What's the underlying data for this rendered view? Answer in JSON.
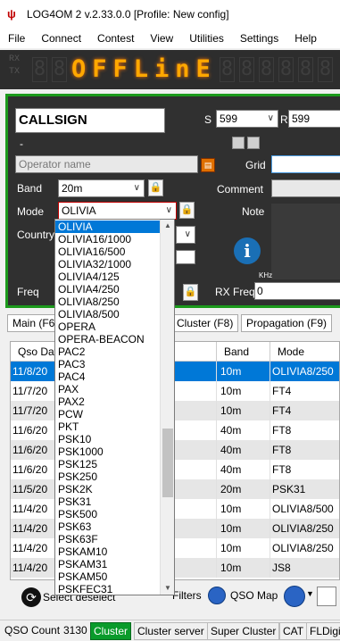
{
  "window": {
    "title": "LOG4OM 2 v.2.33.0.0 [Profile: New config]"
  },
  "menu": [
    "File",
    "Connect",
    "Contest",
    "View",
    "Utilities",
    "Settings",
    "Help"
  ],
  "led": {
    "rx_label": "RX",
    "tx_label": "TX",
    "display_text": "OFFLinE"
  },
  "qso_form": {
    "callsign_placeholder": "CALLSIGN",
    "dash": "-",
    "rst_sent_label": "S",
    "rst_sent_value": "599",
    "rst_rcvd_label": "R",
    "rst_rcvd_value": "599",
    "operator_placeholder": "Operator name",
    "grid_label": "Grid",
    "band_label": "Band",
    "band_value": "20m",
    "comment_label": "Comment",
    "mode_label": "Mode",
    "mode_value": "OLIVIA",
    "note_label": "Note",
    "country_label": "Country",
    "freq_label": "Freq",
    "rx_freq_label": "RX Freq",
    "rx_freq_value": "0",
    "khz_label": "KHz"
  },
  "tabs": [
    "Main (F6",
    "Cluster (F8)",
    "Propagation (F9)"
  ],
  "grid": {
    "columns": [
      "Qso Date",
      "Band",
      "Mode"
    ],
    "rows": [
      {
        "date": "11/8/20",
        "band": "10m",
        "mode": "OLIVIA8/250"
      },
      {
        "date": "11/7/20",
        "band": "10m",
        "mode": "FT4"
      },
      {
        "date": "11/7/20",
        "band": "10m",
        "mode": "FT4"
      },
      {
        "date": "11/6/20",
        "band": "40m",
        "mode": "FT8"
      },
      {
        "date": "11/6/20",
        "band": "40m",
        "mode": "FT8"
      },
      {
        "date": "11/6/20",
        "band": "40m",
        "mode": "FT8"
      },
      {
        "date": "11/5/20",
        "band": "20m",
        "mode": "PSK31"
      },
      {
        "date": "11/4/20",
        "band": "10m",
        "mode": "OLIVIA8/500"
      },
      {
        "date": "11/4/20",
        "band": "10m",
        "mode": "OLIVIA8/250"
      },
      {
        "date": "11/4/20",
        "band": "10m",
        "mode": "OLIVIA8/250"
      },
      {
        "date": "11/4/20",
        "band": "10m",
        "mode": "JS8"
      }
    ]
  },
  "bottom_toolbar": {
    "select_deselect": "Select deselect",
    "filters": "Filters",
    "qso_map": "QSO Map"
  },
  "status": {
    "qso_count_label": "QSO Count",
    "qso_count_value": "3130",
    "cluster": "Cluster",
    "cluster_server": "Cluster server",
    "super_cluster": "Super Cluster",
    "cat": "CAT",
    "fldigi": "FLDigi"
  },
  "mode_dropdown": {
    "options": [
      "OLIVIA",
      "OLIVIA16/1000",
      "OLIVIA16/500",
      "OLIVIA32/1000",
      "OLIVIA4/125",
      "OLIVIA4/250",
      "OLIVIA8/250",
      "OLIVIA8/500",
      "OPERA",
      "OPERA-BEACON",
      "PAC2",
      "PAC3",
      "PAC4",
      "PAX",
      "PAX2",
      "PCW",
      "PKT",
      "PSK10",
      "PSK1000",
      "PSK125",
      "PSK250",
      "PSK2K",
      "PSK31",
      "PSK500",
      "PSK63",
      "PSK63F",
      "PSKAM10",
      "PSKAM31",
      "PSKAM50",
      "PSKFEC31"
    ],
    "selected": "OLIVIA"
  },
  "colors": {
    "panel_border": "#1c9a1c",
    "selection": "#0078d7",
    "led": "#ffa800",
    "status_green": "#0a9b2b"
  }
}
